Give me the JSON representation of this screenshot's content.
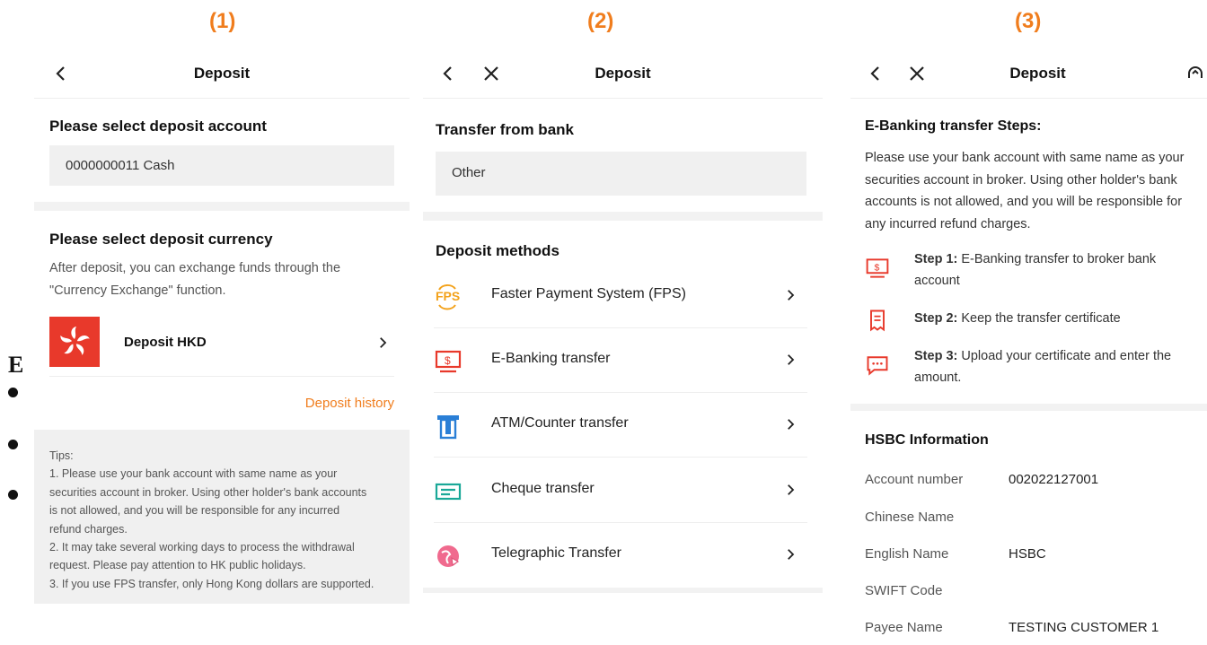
{
  "labels": {
    "p1": "(1)",
    "p2": "(2)",
    "p3": "(3)"
  },
  "overlay": {
    "letter": "E"
  },
  "screen1": {
    "title": "Deposit",
    "account_heading": "Please select deposit account",
    "account_value": "0000000011 Cash",
    "currency_heading": "Please select deposit currency",
    "currency_desc_1": "After deposit, you can exchange funds through the",
    "currency_desc_2": "\"Currency Exchange\" function.",
    "currency_item": "Deposit HKD",
    "history_link": "Deposit history",
    "tips": [
      "Tips:",
      "1. Please use your bank account with same name as your",
      "securities account in broker. Using other holder's bank accounts",
      "is not allowed, and you will be responsible for any incurred",
      "refund charges.",
      "2. It may take several working days to process the withdrawal",
      "request. Please pay attention to HK public holidays.",
      "3. If you use FPS transfer, only Hong Kong dollars are supported."
    ]
  },
  "screen2": {
    "title": "Deposit",
    "bank_heading": "Transfer from bank",
    "bank_value": "Other",
    "methods_heading": "Deposit methods",
    "methods": [
      {
        "label": "Faster Payment System (FPS)",
        "icon": "fps-icon"
      },
      {
        "label": "E-Banking transfer",
        "icon": "monitor-dollar-icon"
      },
      {
        "label": "ATM/Counter transfer",
        "icon": "atm-icon"
      },
      {
        "label": "Cheque transfer",
        "icon": "cheque-icon"
      },
      {
        "label": "Telegraphic Transfer",
        "icon": "globe-arrow-icon"
      }
    ]
  },
  "screen3": {
    "title": "Deposit",
    "steps_heading": "E-Banking transfer Steps:",
    "desc": [
      "Please use your bank account with same name as your",
      "securities account in broker. Using other holder's bank",
      "accounts is not allowed, and you will be responsible for",
      "any incurred refund charges."
    ],
    "steps": [
      {
        "bold": "Step 1:",
        "text": " E-Banking transfer to broker bank",
        "text2": "account"
      },
      {
        "bold": "Step 2:",
        "text": " Keep the transfer certificate",
        "text2": ""
      },
      {
        "bold": "Step 3:",
        "text": " Upload your certificate and enter the",
        "text2": "amount."
      }
    ],
    "info_heading": "HSBC Information",
    "info": [
      {
        "k": "Account number",
        "v": "002022127001"
      },
      {
        "k": "Chinese Name",
        "v": ""
      },
      {
        "k": "English Name",
        "v": "HSBC"
      },
      {
        "k": "SWIFT Code",
        "v": ""
      },
      {
        "k": "Payee Name",
        "v": "TESTING CUSTOMER 1"
      }
    ]
  },
  "colors": {
    "accent": "#f07d1d",
    "red": "#e8392b",
    "blue": "#2a7fd6",
    "teal": "#1aa898"
  }
}
